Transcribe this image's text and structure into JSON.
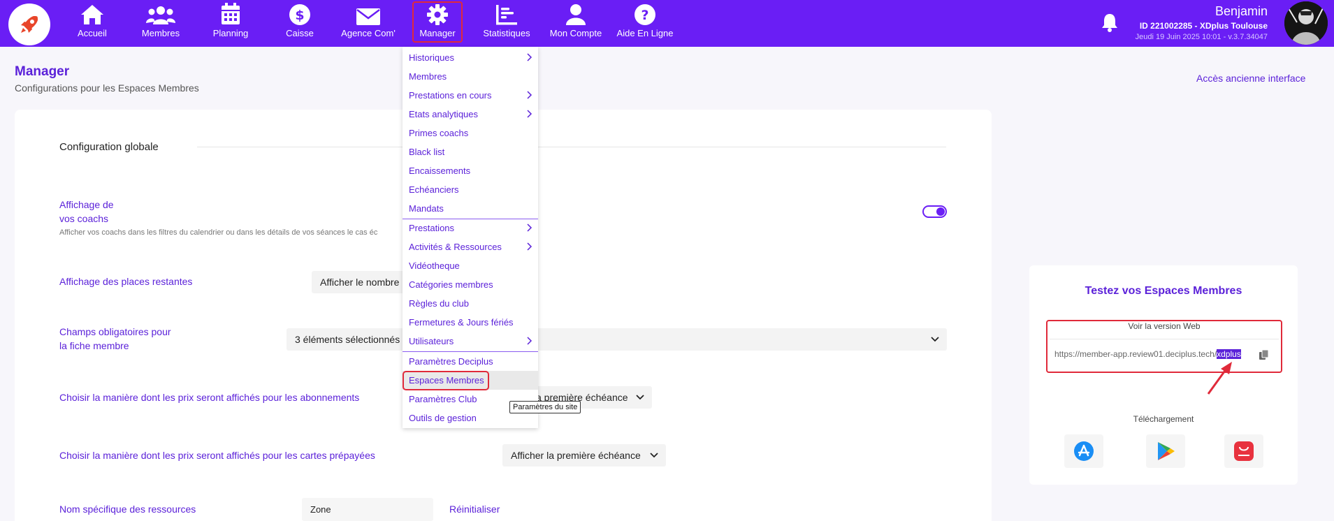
{
  "nav": {
    "items": [
      {
        "label": "Accueil",
        "icon": "home-icon"
      },
      {
        "label": "Membres",
        "icon": "users-icon"
      },
      {
        "label": "Planning",
        "icon": "calendar-icon"
      },
      {
        "label": "Caisse",
        "icon": "dollar-icon"
      },
      {
        "label": "Agence Com'",
        "icon": "envelope-icon"
      },
      {
        "label": "Manager",
        "icon": "gear-icon"
      },
      {
        "label": "Statistiques",
        "icon": "bar-chart-icon"
      },
      {
        "label": "Mon Compte",
        "icon": "user-icon"
      },
      {
        "label": "Aide En Ligne",
        "icon": "question-icon"
      }
    ],
    "active": "Manager"
  },
  "user": {
    "name": "Benjamin",
    "id_line": "ID 221002285 - XDplus Toulouse",
    "date_line": "Jeudi 19 Juin 2025 10:01 - v.3.7.34047"
  },
  "header": {
    "title": "Manager",
    "subtitle": "Configurations pour les Espaces Membres",
    "old_interface_link": "Accès ancienne interface"
  },
  "config": {
    "section_title": "Configuration globale",
    "coachs_label_1": "Affichage de",
    "coachs_label_2": "vos coachs",
    "coachs_desc": "Afficher vos coachs dans les filtres du calendrier ou dans les détails de vos séances le cas éc",
    "coachs_toggle_on": true,
    "places_label": "Affichage des places restantes",
    "places_value": "Afficher le nombre",
    "champs_label_1": "Champs obligatoires pour",
    "champs_label_2": "la fiche membre",
    "champs_value": "3 éléments sélectionnés",
    "prix_abos_label": "Choisir la manière dont les prix seront affichés pour les abonnements",
    "prix_abos_value": "a première échéance",
    "prix_cartes_label": "Choisir la manière dont les prix seront affichés pour les cartes prépayées",
    "prix_cartes_value": "Afficher la première échéance",
    "ressources_label": "Nom spécifique des ressources",
    "ressources_value": "Zone",
    "reset_label": "Réinitialiser"
  },
  "menu": {
    "items": [
      {
        "label": "Historiques",
        "submenu": true
      },
      {
        "label": "Membres",
        "submenu": false
      },
      {
        "label": "Prestations en cours",
        "submenu": true
      },
      {
        "label": "Etats analytiques",
        "submenu": true
      },
      {
        "label": "Primes coachs",
        "submenu": false
      },
      {
        "label": "Black list",
        "submenu": false
      },
      {
        "label": "Encaissements",
        "submenu": false
      },
      {
        "label": "Echéanciers",
        "submenu": false
      },
      {
        "label": "Mandats",
        "submenu": false
      },
      {
        "label": "Prestations",
        "submenu": true
      },
      {
        "label": "Activités & Ressources",
        "submenu": true
      },
      {
        "label": "Vidéotheque",
        "submenu": false
      },
      {
        "label": "Catégories membres",
        "submenu": false
      },
      {
        "label": "Règles du club",
        "submenu": false
      },
      {
        "label": "Fermetures & Jours fériés",
        "submenu": false
      },
      {
        "label": "Utilisateurs",
        "submenu": true
      },
      {
        "label": "Paramètres Deciplus",
        "submenu": false
      },
      {
        "label": "Espaces Membres",
        "submenu": false,
        "selected": true
      },
      {
        "label": "Paramètres Club",
        "submenu": false
      },
      {
        "label": "Outils de gestion",
        "submenu": false
      }
    ],
    "tooltip": "Paramètres du site"
  },
  "test_panel": {
    "title": "Testez vos Espaces Membres",
    "web_label": "Voir la version Web",
    "url_prefix": "https://member-app.review01.deciplus.tech/",
    "url_slug": "xdplus",
    "download_label": "Téléchargement",
    "stores": [
      "app-store-icon",
      "google-play-icon",
      "huawei-appgallery-icon"
    ]
  },
  "colors": {
    "primary": "#6a1ef5",
    "link": "#5b21d9",
    "highlight_border": "#e02a3a",
    "background": "#f7f6fb"
  }
}
